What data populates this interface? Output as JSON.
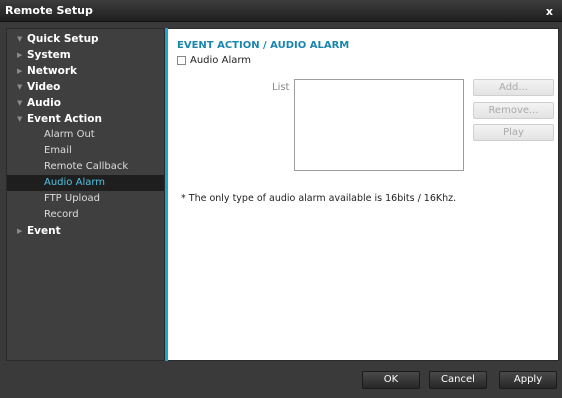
{
  "window": {
    "title": "Remote Setup",
    "close_glyph": "x"
  },
  "sidebar": {
    "items": [
      {
        "label": "Quick Setup",
        "level": "top",
        "arrow": "▼"
      },
      {
        "label": "System",
        "level": "top",
        "arrow": "▶"
      },
      {
        "label": "Network",
        "level": "top",
        "arrow": "▶"
      },
      {
        "label": "Video",
        "level": "top",
        "arrow": "▼"
      },
      {
        "label": "Audio",
        "level": "top",
        "arrow": "▼"
      },
      {
        "label": "Event Action",
        "level": "top",
        "arrow": "▼"
      },
      {
        "label": "Alarm Out",
        "level": "sub"
      },
      {
        "label": "Email",
        "level": "sub"
      },
      {
        "label": "Remote Callback",
        "level": "sub"
      },
      {
        "label": "Audio Alarm",
        "level": "sub",
        "selected": true
      },
      {
        "label": "FTP Upload",
        "level": "sub"
      },
      {
        "label": "Record",
        "level": "sub"
      },
      {
        "label": "Event",
        "level": "top",
        "arrow": "▶"
      }
    ]
  },
  "main": {
    "heading": "EVENT ACTION / AUDIO ALARM",
    "audio_alarm_checkbox": {
      "label": "Audio Alarm",
      "checked": false
    },
    "list_label": "List",
    "buttons": {
      "add": "Add...",
      "remove": "Remove...",
      "play": "Play"
    },
    "note": "* The only type of audio alarm available is 16bits / 16Khz."
  },
  "footer": {
    "ok": "OK",
    "cancel": "Cancel",
    "apply": "Apply"
  },
  "colors": {
    "accent": "#1aa6c9",
    "heading": "#1a86b0",
    "selected_text": "#4fc4e4"
  }
}
